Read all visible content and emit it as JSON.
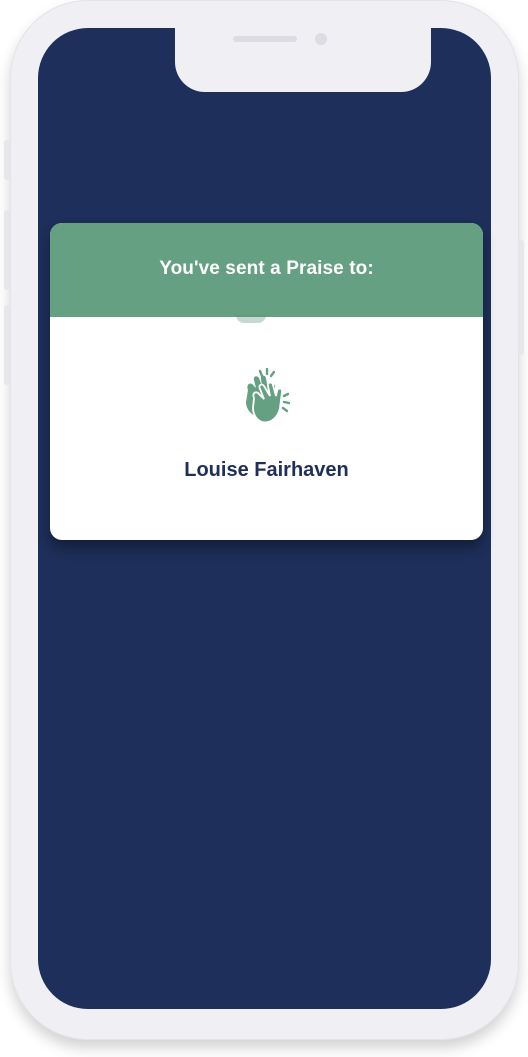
{
  "praise_dialog": {
    "header_text": "You've sent a Praise to:",
    "icon": "clapping-hands-icon",
    "recipient_name": "Louise Fairhaven"
  },
  "colors": {
    "screen_background": "#1d2f5a",
    "header_green": "#65a083",
    "name_text": "#1d2f5a",
    "card_background": "#ffffff"
  }
}
